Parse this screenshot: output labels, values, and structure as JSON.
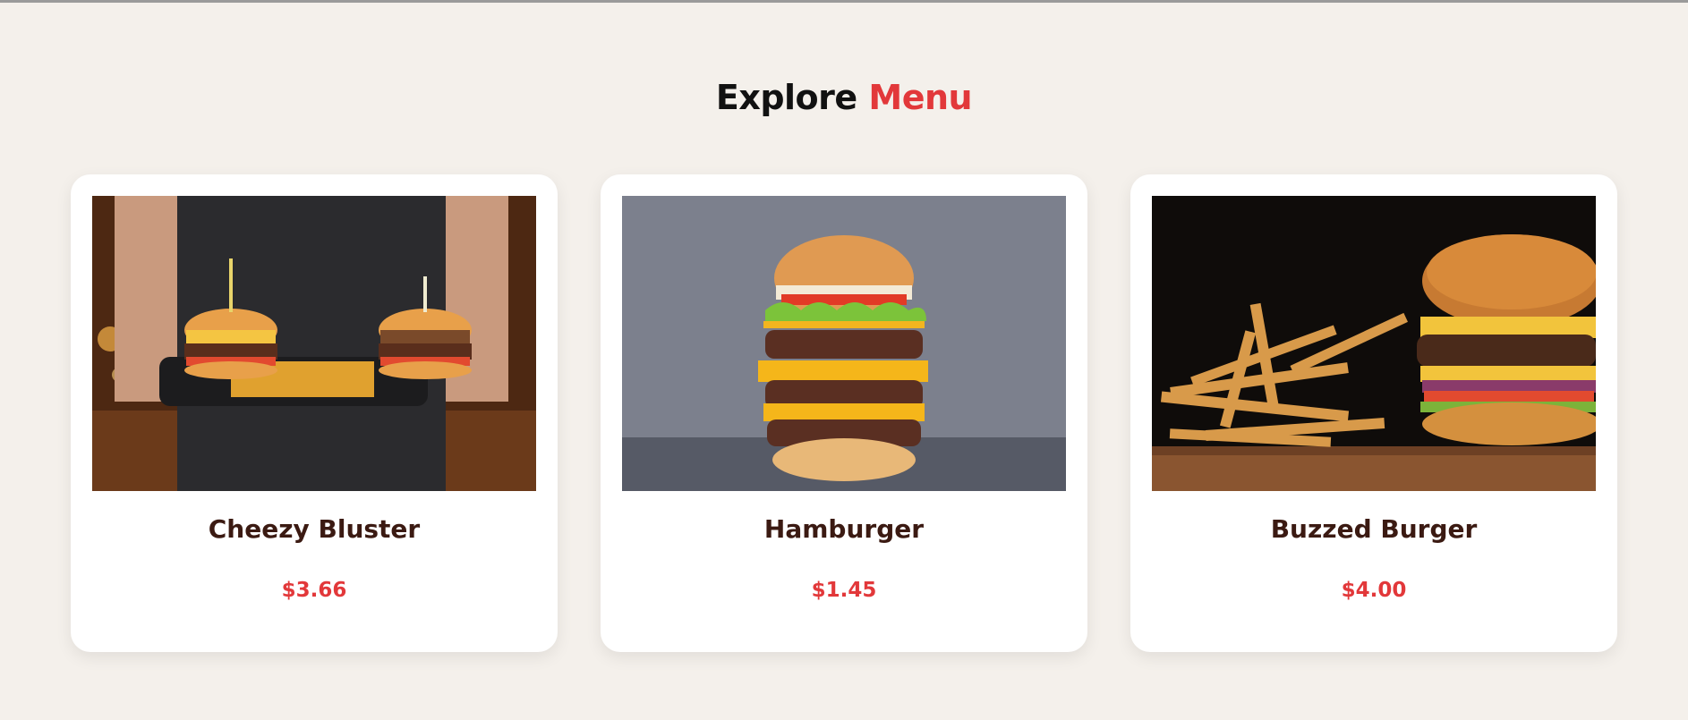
{
  "heading": {
    "text": "Explore",
    "accent": "Menu"
  },
  "colors": {
    "background": "#f4f0eb",
    "accent": "#e2383a",
    "title": "#3b1a12",
    "card": "#ffffff"
  },
  "menu": {
    "items": [
      {
        "name": "Cheezy Bluster",
        "price": "$3.66",
        "image": "burger-tray-photo"
      },
      {
        "name": "Hamburger",
        "price": "$1.45",
        "image": "stacked-burger-photo"
      },
      {
        "name": "Buzzed Burger",
        "price": "$4.00",
        "image": "burger-fries-photo"
      }
    ]
  }
}
